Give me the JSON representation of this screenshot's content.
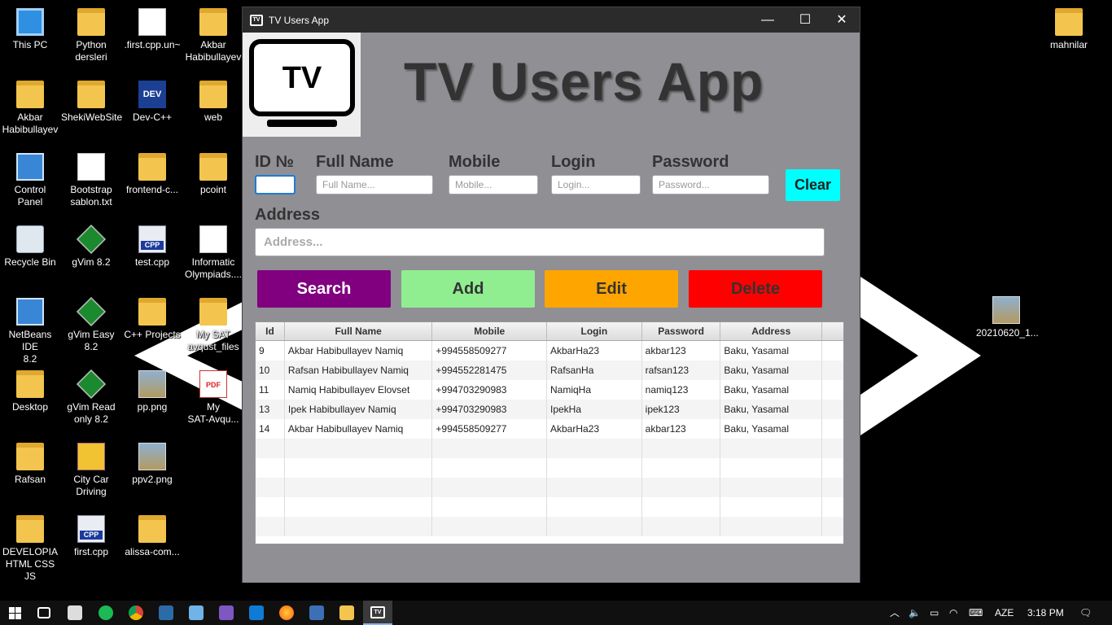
{
  "desktop": {
    "icons": [
      {
        "label": "This PC"
      },
      {
        "label": "Python\ndersleri"
      },
      {
        "label": ".first.cpp.un~"
      },
      {
        "label": "Akbar\nHabibullayev"
      },
      {
        "label": "Akbar\nHabibullayev"
      },
      {
        "label": "ShekiWebSite"
      },
      {
        "label": "Dev-C++"
      },
      {
        "label": "web"
      },
      {
        "label": "Control\nPanel"
      },
      {
        "label": "Bootstrap\nsablon.txt"
      },
      {
        "label": "frontend-c..."
      },
      {
        "label": "pcoint"
      },
      {
        "label": "Recycle Bin"
      },
      {
        "label": "gVim 8.2"
      },
      {
        "label": "test.cpp"
      },
      {
        "label": "Informatic\nOlympiads...."
      },
      {
        "label": "NetBeans IDE\n8.2"
      },
      {
        "label": "gVim Easy\n8.2"
      },
      {
        "label": "C++ Projects"
      },
      {
        "label": "My SAT\navqust_files"
      },
      {
        "label": "Desktop"
      },
      {
        "label": "gVim Read\nonly 8.2"
      },
      {
        "label": "pp.png"
      },
      {
        "label": "My\nSAT-Avqu..."
      },
      {
        "label": "Rafsan"
      },
      {
        "label": "City Car\nDriving"
      },
      {
        "label": "ppv2.png"
      },
      {
        "label": "DEVELOPIA\nHTML CSS JS"
      },
      {
        "label": "first.cpp"
      },
      {
        "label": "alissa-com..."
      },
      {
        "label": "mahnilar"
      },
      {
        "label": "20210620_1..."
      }
    ]
  },
  "window": {
    "title": "TV Users App",
    "icon_text": "TV",
    "minimize": "—",
    "maximize": "☐",
    "close": "✕"
  },
  "logo": {
    "text": "TV"
  },
  "heading": "TV Users App",
  "form": {
    "id_label": "ID №",
    "id_value": "",
    "fullname_label": "Full Name",
    "fullname_placeholder": "Full Name...",
    "mobile_label": "Mobile",
    "mobile_placeholder": "Mobile...",
    "login_label": "Login",
    "login_placeholder": "Login...",
    "password_label": "Password",
    "password_placeholder": "Password...",
    "clear_label": "Clear",
    "address_label": "Address",
    "address_placeholder": "Address..."
  },
  "actions": {
    "search": {
      "label": "Search",
      "bg": "#800080",
      "fg": "#ffffff"
    },
    "add": {
      "label": "Add",
      "bg": "#90ee90",
      "fg": "#333333"
    },
    "edit": {
      "label": "Edit",
      "bg": "#ffa500",
      "fg": "#333333"
    },
    "delete": {
      "label": "Delete",
      "bg": "#ff0000",
      "fg": "#333333"
    }
  },
  "table": {
    "columns": [
      "Id",
      "Full Name",
      "Mobile",
      "Login",
      "Password",
      "Address"
    ],
    "rows": [
      [
        "9",
        "Akbar Habibullayev Namiq",
        "+994558509277",
        "AkbarHa23",
        "akbar123",
        "Baku, Yasamal"
      ],
      [
        "10",
        "Rafsan Habibullayev Namiq",
        "+994552281475",
        "RafsanHa",
        "rafsan123",
        "Baku, Yasamal"
      ],
      [
        "11",
        "Namiq Habibullayev Elovset",
        "+994703290983",
        "NamiqHa",
        "namiq123",
        "Baku, Yasamal"
      ],
      [
        "13",
        "Ipek Habibullayev Namiq",
        "+994703290983",
        "IpekHa",
        "ipek123",
        "Baku, Yasamal"
      ],
      [
        "14",
        "Akbar Habibullayev Namiq",
        "+994558509277",
        "AkbarHa23",
        "akbar123",
        "Baku, Yasamal"
      ]
    ]
  },
  "taskbar": {
    "language": "AZE",
    "time": "3:18 PM"
  }
}
